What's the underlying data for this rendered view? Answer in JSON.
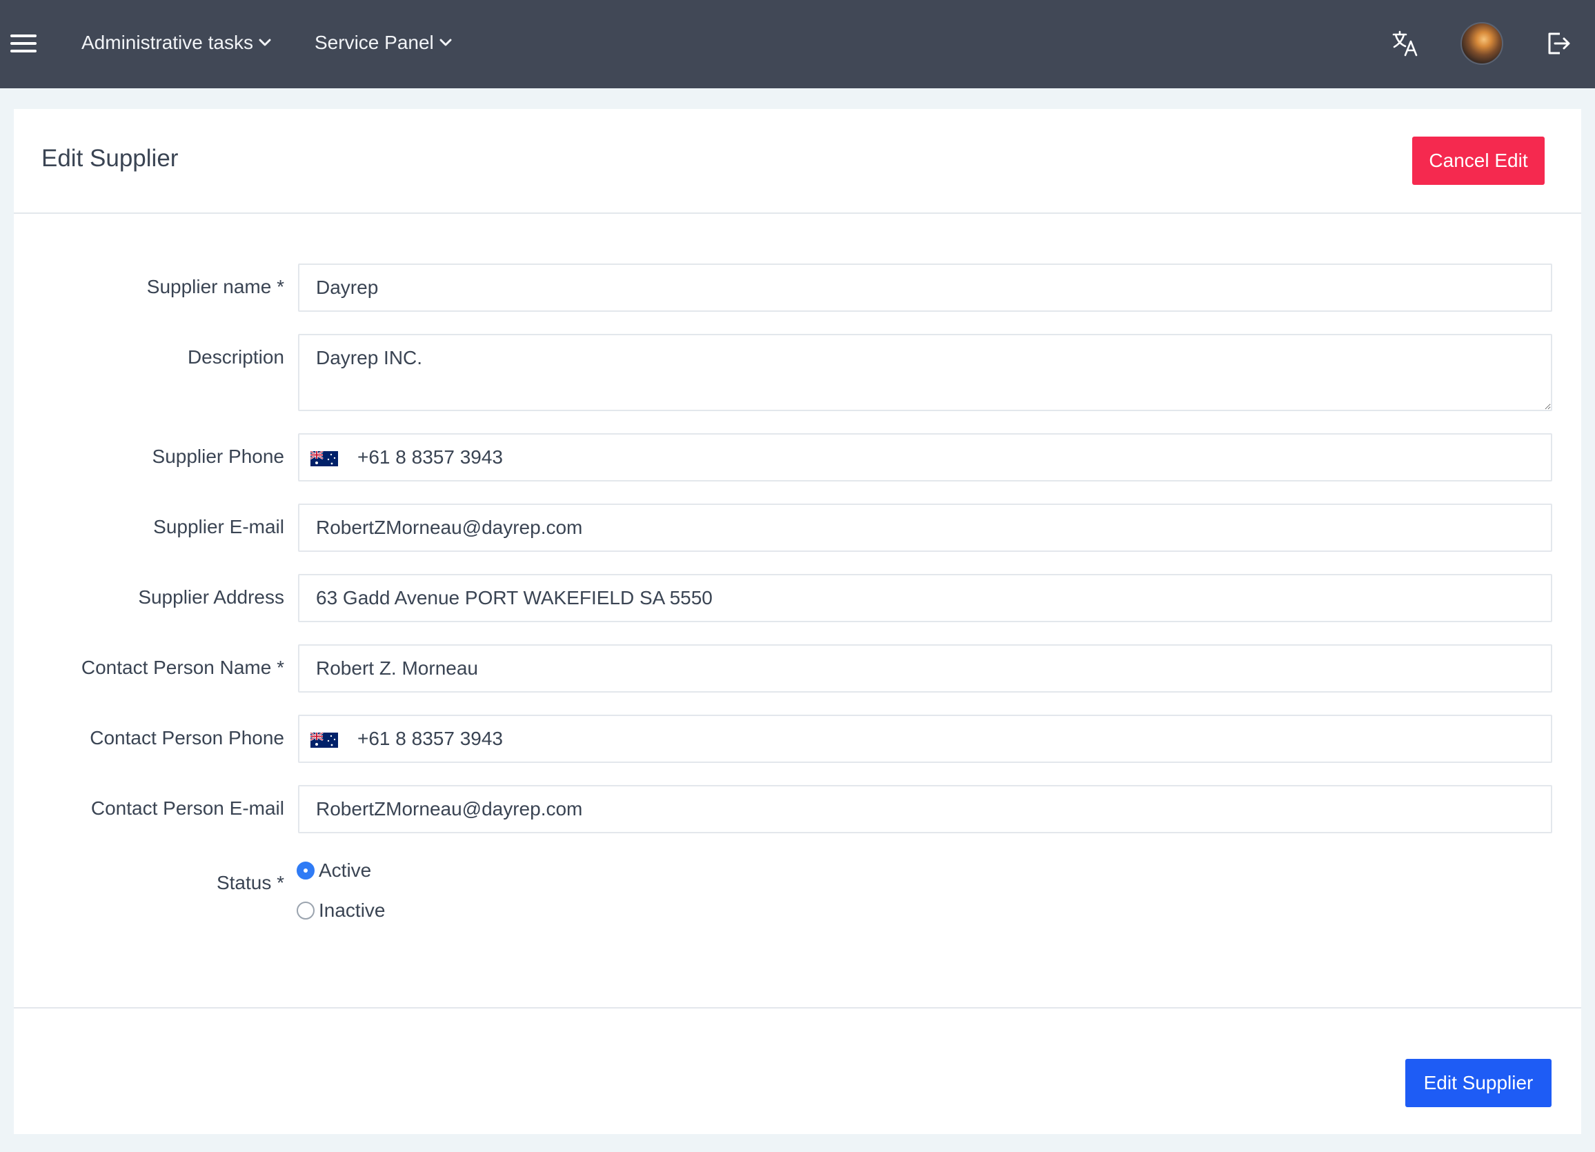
{
  "navbar": {
    "menu_icon": "hamburger-icon",
    "admin_tasks": "Administrative tasks",
    "service_panel": "Service Panel",
    "translate_icon": "translate-icon",
    "logout_icon": "logout-icon"
  },
  "header": {
    "title": "Edit Supplier",
    "cancel_label": "Cancel Edit"
  },
  "form": {
    "supplier_name": {
      "label": "Supplier name *",
      "value": "Dayrep"
    },
    "description": {
      "label": "Description",
      "value": "Dayrep INC."
    },
    "supplier_phone": {
      "label": "Supplier Phone",
      "value": "+61 8 8357 3943",
      "flag": "australia-flag-icon"
    },
    "supplier_email": {
      "label": "Supplier E-mail",
      "value": "RobertZMorneau@dayrep.com"
    },
    "supplier_address": {
      "label": "Supplier Address",
      "value": "63 Gadd Avenue PORT WAKEFIELD SA 5550"
    },
    "contact_name": {
      "label": "Contact Person Name *",
      "value": "Robert Z. Morneau"
    },
    "contact_phone": {
      "label": "Contact Person Phone",
      "value": "+61 8 8357 3943",
      "flag": "australia-flag-icon"
    },
    "contact_email": {
      "label": "Contact Person E-mail",
      "value": "RobertZMorneau@dayrep.com"
    },
    "status": {
      "label": "Status *",
      "options": [
        "Active",
        "Inactive"
      ],
      "selected": "Active"
    }
  },
  "footer": {
    "submit_label": "Edit Supplier"
  },
  "colors": {
    "navbar": "#414856",
    "cancel": "#f5294f",
    "submit": "#1e5cf5",
    "radio_checked": "#2f7bf5"
  }
}
